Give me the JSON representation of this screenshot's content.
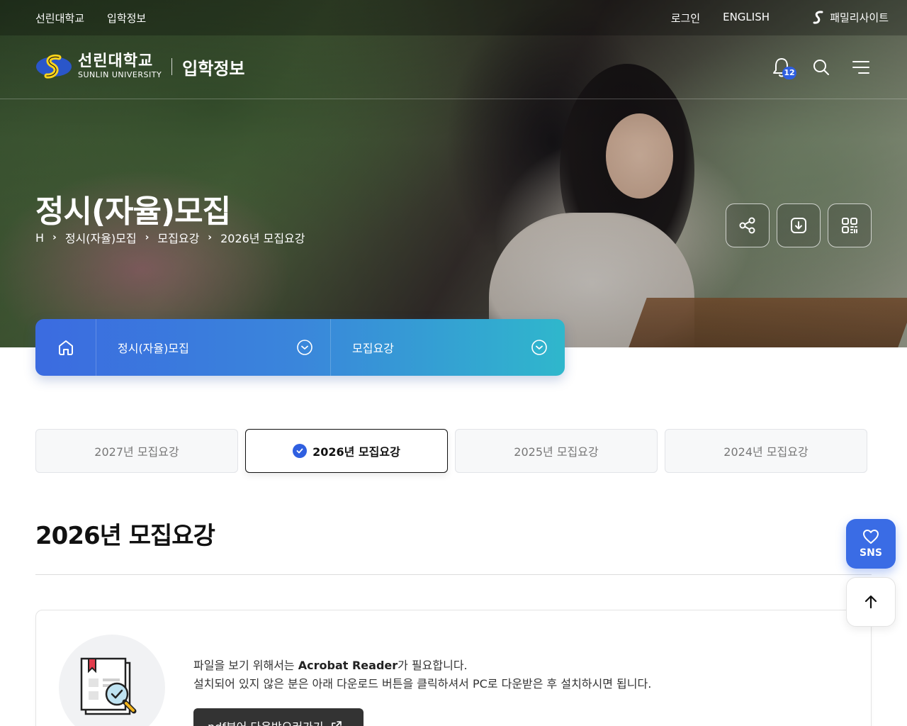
{
  "topbar": {
    "left_links": [
      "선린대학교",
      "입학정보"
    ],
    "login": "로그인",
    "english": "ENGLISH",
    "family_site": "패밀리사이트"
  },
  "header": {
    "logo_ko": "선린대학교",
    "logo_en": "SUNLIN UNIVERSITY",
    "logo_sub": "입학정보",
    "notification_count": "12"
  },
  "hero": {
    "title": "정시(자율)모집",
    "breadcrumb": [
      "H",
      "정시(자율)모집",
      "모집요강",
      "2026년 모집요강"
    ]
  },
  "localnav": {
    "depth1": "정시(자율)모집",
    "depth2": "모집요강"
  },
  "year_tabs": [
    {
      "label": "2027년 모집요강",
      "active": false
    },
    {
      "label": "2026년 모집요강",
      "active": true
    },
    {
      "label": "2025년 모집요강",
      "active": false
    },
    {
      "label": "2024년 모집요강",
      "active": false
    }
  ],
  "content": {
    "section_title": "2026년 모집요강",
    "notice_line1_prefix": "파일을 보기 위해서는 ",
    "notice_line1_bold": "Acrobat Reader",
    "notice_line1_suffix": "가 필요합니다.",
    "notice_line2": "설치되어 있지 않은 분은 아래 다운로드 버튼을 클릭하셔서 PC로 다운받은 후 설치하시면 됩니다.",
    "pdf_button": "pdf뷰어 다운받으러가기"
  },
  "floating": {
    "sns_label": "SNS"
  },
  "colors": {
    "primary_blue": "#3a6ce5",
    "nav_gradient_start": "#3b6be0",
    "nav_gradient_end": "#2fb7cc",
    "badge_blue": "#2f5fe0"
  }
}
